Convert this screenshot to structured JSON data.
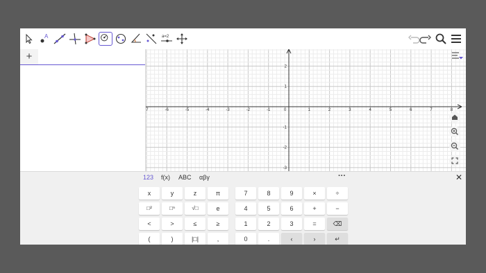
{
  "toolbar": {
    "tools": [
      {
        "name": "move-tool-icon"
      },
      {
        "name": "point-tool-icon"
      },
      {
        "name": "line-tool-icon"
      },
      {
        "name": "perpendicular-tool-icon"
      },
      {
        "name": "polygon-tool-icon"
      },
      {
        "name": "circle-tool-icon",
        "active": true
      },
      {
        "name": "ellipse-tool-icon"
      },
      {
        "name": "angle-tool-icon"
      },
      {
        "name": "reflect-tool-icon"
      },
      {
        "name": "slider-tool-icon",
        "label": "a=2"
      },
      {
        "name": "move-graphics-view-icon"
      }
    ],
    "right": [
      "undo-icon",
      "redo-icon",
      "search-icon",
      "menu-icon"
    ],
    "accent": "#6557d2"
  },
  "algebra": {
    "add_label": "+",
    "input_value": "",
    "input_placeholder": ""
  },
  "graphics": {
    "x_ticks": [
      "-7",
      "-6",
      "-5",
      "-4",
      "-3",
      "-2",
      "-1",
      "0",
      "1",
      "2",
      "3",
      "4",
      "5",
      "6",
      "7",
      "8"
    ],
    "y_ticks": [
      "2",
      "1",
      "-1",
      "-2",
      "-3"
    ],
    "buttons": [
      "home-icon",
      "zoom-in-icon",
      "zoom-out-icon",
      "fullscreen-icon"
    ],
    "style_bar_icon": "style-bar-icon"
  },
  "keyboard": {
    "tabs": [
      "123",
      "f(x)",
      "ABC",
      "αβγ"
    ],
    "active_tab": "123",
    "more_label": "···",
    "close_label": "✕",
    "left_keys": [
      [
        "x",
        "y",
        "z",
        "π"
      ],
      [
        "□²",
        "□ⁿ",
        "√□",
        "e"
      ],
      [
        "<",
        ">",
        "≤",
        "≥"
      ],
      [
        "(",
        ")",
        "|□|",
        ","
      ]
    ],
    "right_keys": [
      [
        "7",
        "8",
        "9",
        "×",
        "÷"
      ],
      [
        "4",
        "5",
        "6",
        "+",
        "−"
      ],
      [
        "1",
        "2",
        "3",
        "=",
        "⌫"
      ],
      [
        "0",
        ".",
        "‹",
        "›",
        "↵"
      ]
    ]
  }
}
